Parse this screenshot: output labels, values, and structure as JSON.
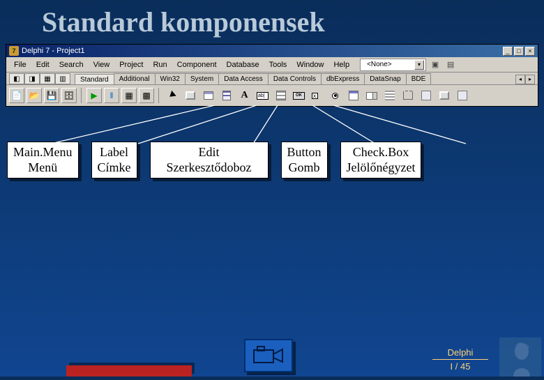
{
  "slide": {
    "title": "Standard komponensek"
  },
  "ide": {
    "title": "Delphi 7 - Project1",
    "menu": [
      "File",
      "Edit",
      "Search",
      "View",
      "Project",
      "Run",
      "Component",
      "Database",
      "Tools",
      "Window",
      "Help"
    ],
    "combo_value": "<None>",
    "tabs": [
      "Standard",
      "Additional",
      "Win32",
      "System",
      "Data Access",
      "Data Controls",
      "dbExpress",
      "DataSnap",
      "BDE"
    ],
    "active_tab": 0,
    "palette_label_A": "A",
    "palette_edit_text": "ab|",
    "palette_button_text": "OK",
    "palette_check_mark": "x"
  },
  "callouts": [
    {
      "en": "Main.Menu",
      "hu": "Menü"
    },
    {
      "en": "Label",
      "hu": "Címke"
    },
    {
      "en": "Edit",
      "hu": "Szerkesztődoboz"
    },
    {
      "en": "Button",
      "hu": "Gomb"
    },
    {
      "en": "Check.Box",
      "hu": "Jelölőnégyzet"
    }
  ],
  "footer": {
    "line1": "Delphi",
    "line2": "I / 45"
  }
}
